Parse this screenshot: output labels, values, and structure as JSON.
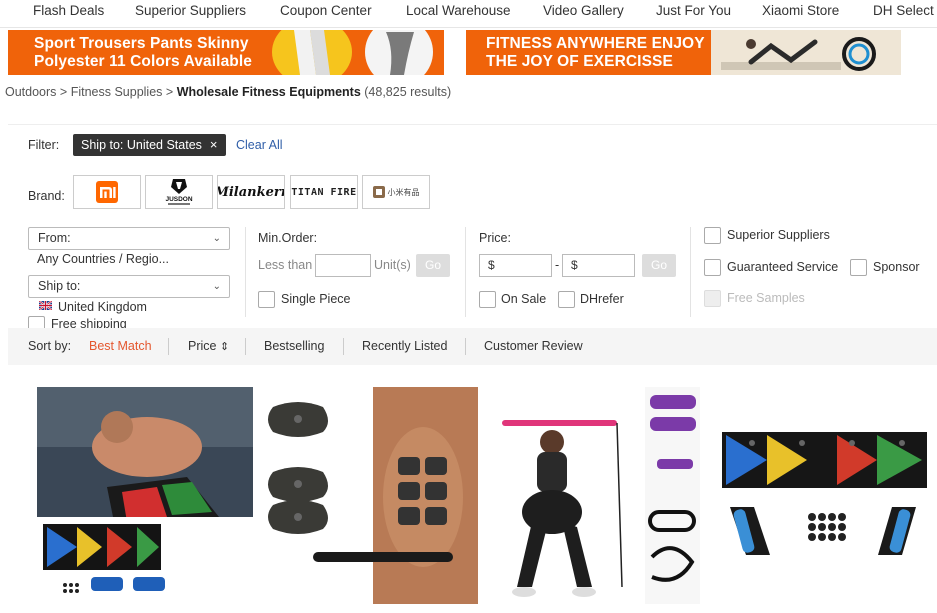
{
  "topnav": {
    "items": [
      "Flash Deals",
      "Superior Suppliers",
      "Coupon Center",
      "Local Warehouse",
      "Video Gallery",
      "Just For You",
      "Xiaomi Store",
      "DH Select"
    ]
  },
  "banners": {
    "left": {
      "line1": "Sport Trousers Pants Skinny",
      "line2": "Polyester 11 Colors Available"
    },
    "right": {
      "line1": "FITNESS ANYWHERE ENJOY",
      "line2": "THE JOY OF EXERCISSE"
    }
  },
  "breadcrumb": {
    "part1": "Outdoors",
    "sep": ">",
    "part2": "Fitness Supplies",
    "current": "Wholesale Fitness Equipments",
    "count": "(48,825 results)"
  },
  "filter": {
    "label": "Filter:",
    "chip": "Ship to: United States",
    "chip_close": "×",
    "clear_all": "Clear All"
  },
  "brand": {
    "label": "Brand:",
    "logos": [
      "xiaomi-logo",
      "jusdon-logo",
      "milankerr-logo",
      "titan-fire-logo",
      "xiaomi-youpin-logo"
    ],
    "logo_texts": {
      "jusdon": "JUSDON",
      "milankerr": "Milankerr",
      "titan": "TITAN FIRE",
      "youpin": "小米有品"
    }
  },
  "location": {
    "from_label": "From:",
    "from_value": "Any Countries / Regio...",
    "shipto_label": "Ship to:",
    "shipto_value": "United Kingdom",
    "free_shipping": "Free shipping"
  },
  "min_order": {
    "label": "Min.Order:",
    "less_than": "Less than",
    "unit": "Unit(s)",
    "go": "Go",
    "single_piece": "Single Piece"
  },
  "price": {
    "label": "Price:",
    "min_placeholder": "$",
    "dash": "-",
    "max_placeholder": "$",
    "go": "Go",
    "on_sale": "On Sale",
    "dhrefer": "DHrefer"
  },
  "options": {
    "superior": "Superior Suppliers",
    "guaranteed": "Guaranteed Service",
    "sponsor": "Sponsor",
    "free_samples": "Free Samples"
  },
  "sort": {
    "label": "Sort by:",
    "best_match": "Best Match",
    "price": "Price",
    "price_icon": "⇕",
    "bestselling": "Bestselling",
    "recently_listed": "Recently Listed",
    "customer_review": "Customer Review",
    "active_color": "#e4572e"
  },
  "colors": {
    "accent": "#f0630a",
    "link": "#2f5ea8"
  }
}
